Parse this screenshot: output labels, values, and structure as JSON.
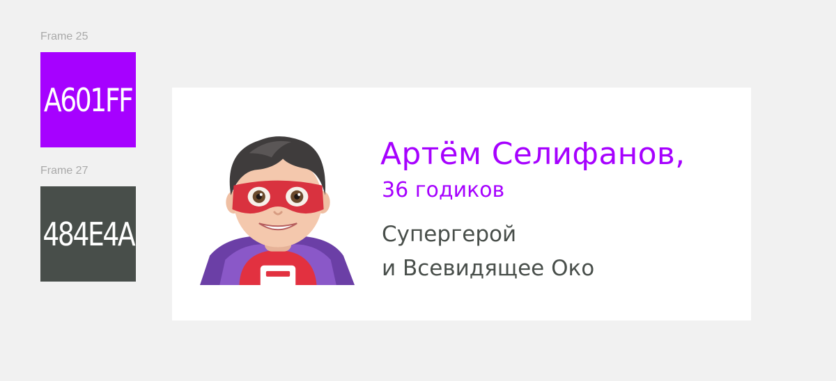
{
  "frames": [
    {
      "label": "Frame 25",
      "swatch_text": "A601FF",
      "color": "#A601FF"
    },
    {
      "label": "Frame 27",
      "swatch_text": "484E4A",
      "color": "#484E4A"
    }
  ],
  "card": {
    "name": "Артём Селифанов,",
    "age": "36 годиков",
    "description": [
      "Супергерой",
      "и Всевидящее Око"
    ],
    "accent_color": "#A601FF",
    "text_color": "#484E4A",
    "avatar_icon": "superhero-memoji-icon"
  }
}
